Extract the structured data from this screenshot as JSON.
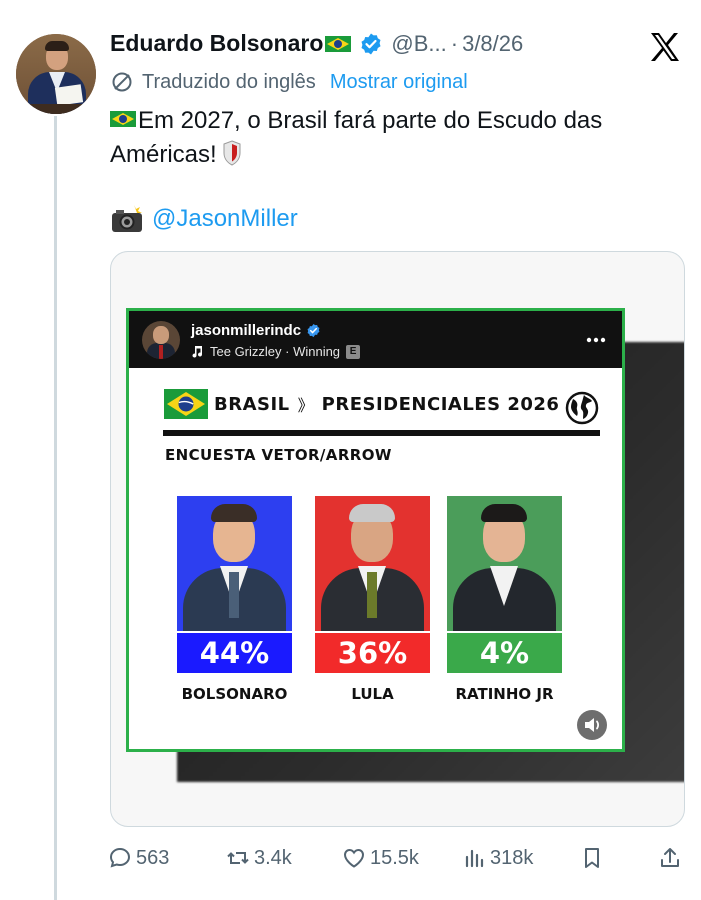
{
  "author": {
    "name": "Eduardo Bolsonaro",
    "handle": "@B...",
    "separator": "·",
    "date": "3/8/26"
  },
  "translation": {
    "label": "Traduzido do inglês",
    "action": "Mostrar original"
  },
  "tweet": {
    "line1": "Em 2027, o Brasil fará parte do Escudo das",
    "line2": "Américas!",
    "mention": "@JasonMiller"
  },
  "embedded_post": {
    "username": "jasonmillerindc",
    "music": "Tee Grizzley · Winning",
    "explicit": "E",
    "title_left": "BRASIL",
    "chevrons": "》",
    "title_right": "PRESIDENCIALES 2026",
    "subtitle": "ENCUESTA VETOR/ARROW",
    "candidates": [
      {
        "name": "BOLSONARO",
        "percent": "44%",
        "color": "#1a1aff",
        "bg": "#2d3ff0"
      },
      {
        "name": "LULA",
        "percent": "36%",
        "color": "#f22a2a",
        "bg": "#e3322f"
      },
      {
        "name": "RATINHO JR",
        "percent": "4%",
        "color": "#3aa94a",
        "bg": "#4b9d5a"
      }
    ]
  },
  "actions": {
    "replies": "563",
    "reposts": "3.4k",
    "likes": "15.5k",
    "views": "318k"
  },
  "colors": {
    "link": "#1d9bf0",
    "secondary_text": "#536471",
    "verified": "#1d9bf0",
    "frame_border": "#2cb04a"
  }
}
